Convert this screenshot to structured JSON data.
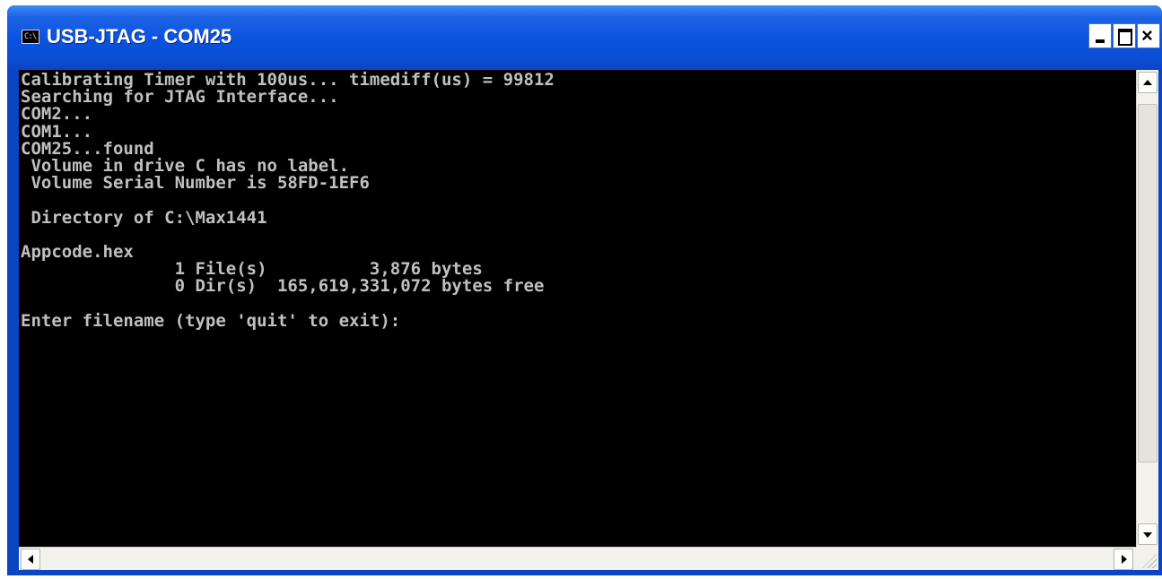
{
  "window": {
    "title": "USB-JTAG - COM25",
    "icon_label": "C:\\",
    "icon": "console-icon",
    "close_glyph": "×"
  },
  "console": {
    "lines": [
      "Calibrating Timer with 100us... timediff(us) = 99812",
      "Searching for JTAG Interface...",
      "COM2...",
      "COM1...",
      "COM25...found",
      " Volume in drive C has no label.",
      " Volume Serial Number is 58FD-1EF6",
      "",
      " Directory of C:\\Max1441",
      "",
      "Appcode.hex",
      "               1 File(s)          3,876 bytes",
      "               0 Dir(s)  165,619,331,072 bytes free",
      "",
      "Enter filename (type 'quit' to exit):"
    ]
  },
  "colors": {
    "titlebar": "#0a52dd",
    "console_bg": "#000000",
    "console_text": "#c0c0c0",
    "scrollbar": "#f2f1eb"
  }
}
